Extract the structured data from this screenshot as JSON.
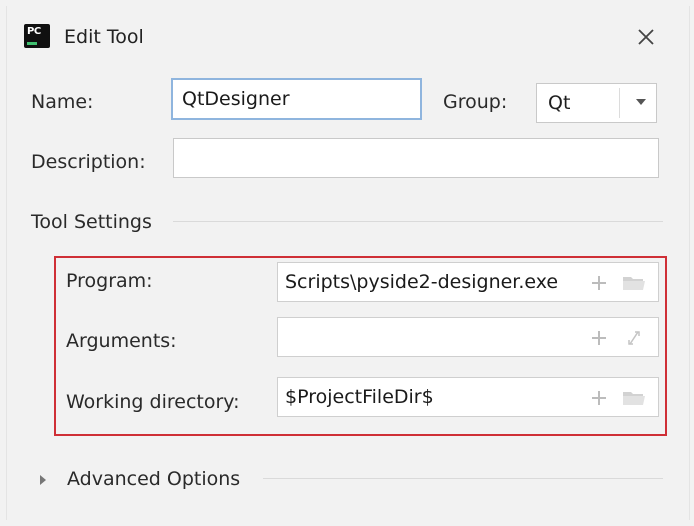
{
  "window": {
    "title": "Edit Tool",
    "app_icon": "pycharm-icon",
    "app_icon_text": "PC",
    "close_icon": "close-icon"
  },
  "form": {
    "name_label": "Name:",
    "name_value": "QtDesigner",
    "group_label": "Group:",
    "group_value": "Qt",
    "description_label": "Description:",
    "description_value": ""
  },
  "tool_settings": {
    "heading": "Tool Settings",
    "program_label": "Program:",
    "program_value": "Scripts\\pyside2-designer.exe",
    "arguments_label": "Arguments:",
    "arguments_value": "",
    "working_dir_label": "Working directory:",
    "working_dir_value": "$ProjectFileDir$",
    "highlight_color": "#cf2f36"
  },
  "advanced": {
    "label": "Advanced Options",
    "expanded": false
  },
  "colors": {
    "focus_border": "#8fb5de",
    "background": "#f2f2f2"
  }
}
